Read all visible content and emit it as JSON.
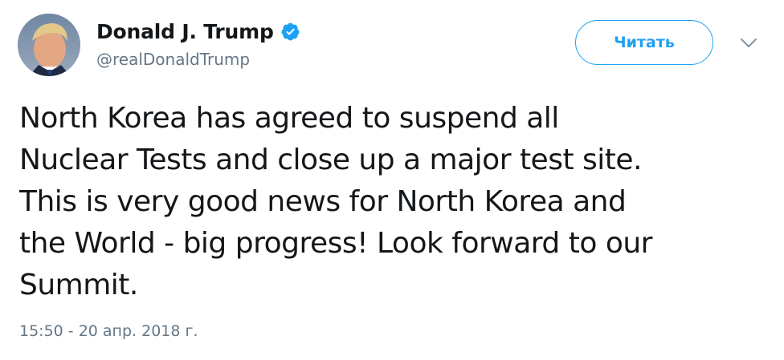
{
  "tweet": {
    "author": {
      "display_name": "Donald J. Trump",
      "handle": "@realDonaldTrump",
      "verified_icon": "verified-badge-icon",
      "avatar_icon": "avatar"
    },
    "follow_button_label": "Читать",
    "menu_icon": "chevron-down-icon",
    "text": "North Korea has agreed to suspend all\nNuclear Tests and close up a major test site.\nThis is very good news for North Korea and\nthe World - big progress! Look forward to our\nSummit.",
    "timestamp": "15:50 - 20 апр. 2018 г."
  },
  "colors": {
    "accent": "#1da1f2",
    "text_primary": "#14171a",
    "text_secondary": "#657786"
  }
}
